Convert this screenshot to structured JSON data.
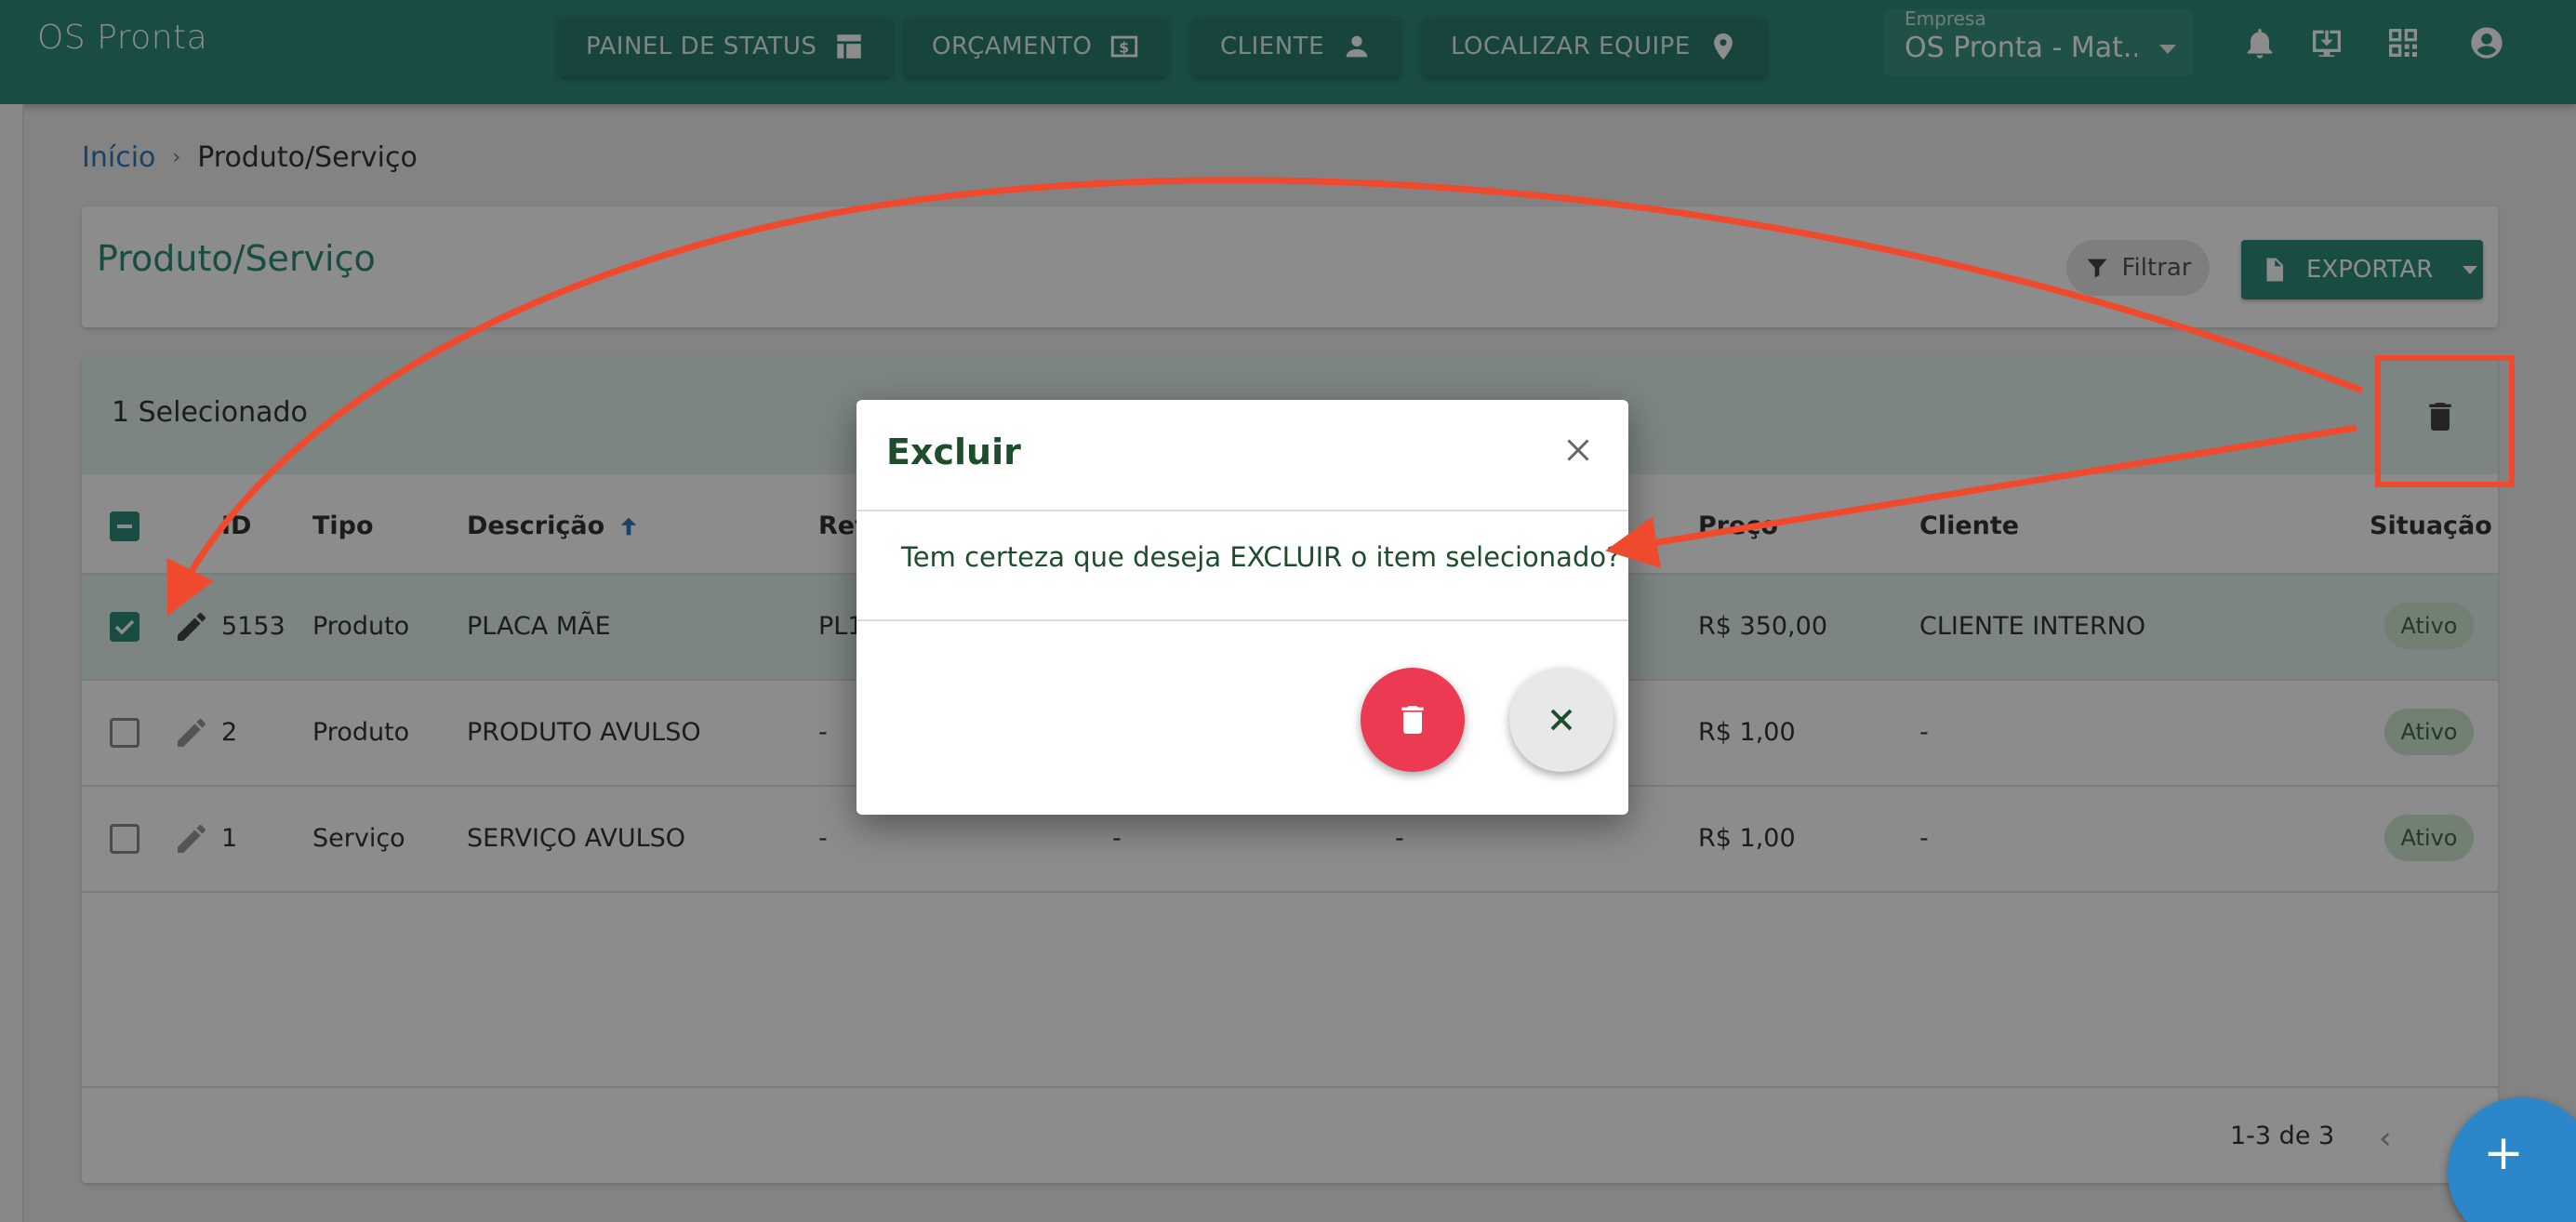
{
  "app": {
    "title": "OS Pronta"
  },
  "nav": [
    {
      "label": "PAINEL DE STATUS",
      "icon": "dashboard-icon"
    },
    {
      "label": "ORÇAMENTO",
      "icon": "money-icon"
    },
    {
      "label": "CLIENTE",
      "icon": "person-icon"
    },
    {
      "label": "LOCALIZAR EQUIPE",
      "icon": "location-pin-icon"
    }
  ],
  "empresa": {
    "label": "Empresa",
    "value": "OS Pronta - Mat..."
  },
  "breadcrumb": {
    "home": "Início",
    "separator": "›",
    "current": "Produto/Serviço"
  },
  "page": {
    "title": "Produto/Serviço",
    "filter_label": "Filtrar",
    "export_label": "EXPORTAR"
  },
  "selection": {
    "text": "1 Selecionado"
  },
  "table": {
    "headers": {
      "id": "ID",
      "tipo": "Tipo",
      "descricao": "Descrição",
      "ref": "Ref",
      "preco": "Preço",
      "cliente": "Cliente",
      "situacao": "Situação"
    },
    "rows": [
      {
        "id": "5153",
        "tipo": "Produto",
        "descricao": "PLACA MÃE",
        "ref": "PL1",
        "col5": "",
        "col6": "",
        "preco": "R$ 350,00",
        "cliente": "CLIENTE INTERNO",
        "situacao": "Ativo",
        "selected": true
      },
      {
        "id": "2",
        "tipo": "Produto",
        "descricao": "PRODUTO AVULSO",
        "ref": "-",
        "col5": "",
        "col6": "",
        "preco": "R$ 1,00",
        "cliente": "-",
        "situacao": "Ativo",
        "selected": false
      },
      {
        "id": "1",
        "tipo": "Serviço",
        "descricao": "SERVIÇO AVULSO",
        "ref": "-",
        "col5": "-",
        "col6": "-",
        "preco": "R$ 1,00",
        "cliente": "-",
        "situacao": "Ativo",
        "selected": false
      }
    ],
    "pagination": "1-3 de 3"
  },
  "dialog": {
    "title": "Excluir",
    "message": "Tem certeza que deseja EXCLUIR o item selecionado?"
  },
  "colors": {
    "primary": "#2f8a78",
    "danger": "#ec3a52",
    "annotation": "#ef4a2e",
    "fab": "#2b87c9"
  }
}
